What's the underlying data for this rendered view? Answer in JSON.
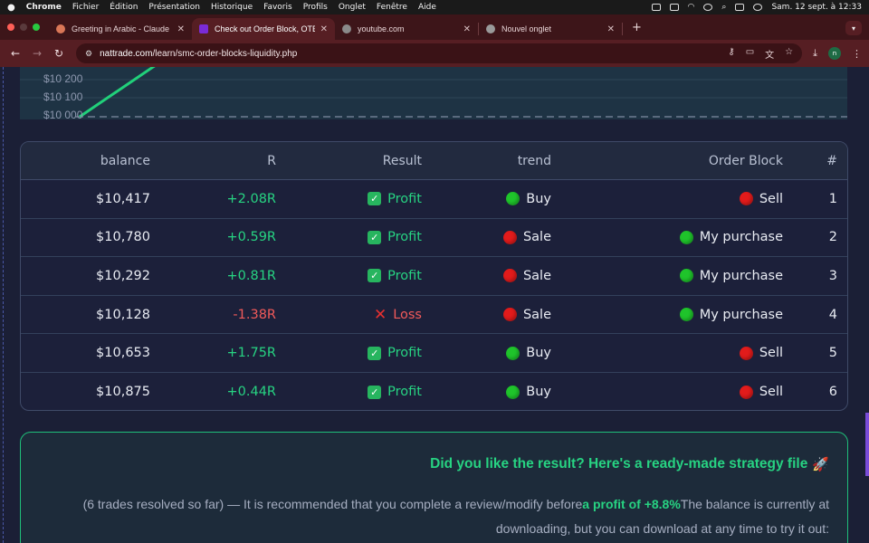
{
  "menubar": {
    "items": [
      "Chrome",
      "Fichier",
      "Édition",
      "Présentation",
      "Historique",
      "Favoris",
      "Profils",
      "Onglet",
      "Fenêtre",
      "Aide"
    ],
    "datetime": "Sam. 12 sept. à  12:33"
  },
  "tabs": [
    {
      "title": "Greeting in Arabic - Claude",
      "favicon_color": "#d97757"
    },
    {
      "title": "Check out Order Block, OTE,",
      "favicon_color": "#7a2bd6"
    },
    {
      "title": "youtube.com",
      "favicon_color": "#8a8a8a"
    },
    {
      "title": "Nouvel onglet",
      "favicon_color": "#9a9a9a"
    }
  ],
  "address_bar": {
    "host": "nattrade.com",
    "path": "/learn/smc-order-blocks-liquidity.php",
    "profile_initial": "n"
  },
  "chart": {
    "y_ticks": [
      "$10 200",
      "$10 100",
      "$10 000"
    ]
  },
  "table": {
    "headers": {
      "balance": "balance",
      "r": "R",
      "result": "Result",
      "trend": "trend",
      "order_block": "Order Block",
      "num": "#"
    },
    "rows": [
      {
        "balance": "$10,417",
        "r": "+2.08R",
        "result": "Profit",
        "trend": "Buy",
        "order_block": "Sell",
        "num": "1"
      },
      {
        "balance": "$10,780",
        "r": "+0.59R",
        "result": "Profit",
        "trend": "Sale",
        "order_block": "My purchase",
        "num": "2"
      },
      {
        "balance": "$10,292",
        "r": "+0.81R",
        "result": "Profit",
        "trend": "Sale",
        "order_block": "My purchase",
        "num": "3"
      },
      {
        "balance": "$10,128",
        "r": "-1.38R",
        "result": "Loss",
        "trend": "Sale",
        "order_block": "My purchase",
        "num": "4"
      },
      {
        "balance": "$10,653",
        "r": "+1.75R",
        "result": "Profit",
        "trend": "Buy",
        "order_block": "Sell",
        "num": "5"
      },
      {
        "balance": "$10,875",
        "r": "+0.44R",
        "result": "Profit",
        "trend": "Buy",
        "order_block": "Sell",
        "num": "6"
      }
    ]
  },
  "promo": {
    "title": "Did you like the result? Here's a ready-made strategy file",
    "text_before": "(6 trades resolved so far) — It is recommended that you complete a review/modify before",
    "highlight": "a profit of +8.8%",
    "text_after": "The balance is currently at downloading, but you can download at any time to try it out:"
  }
}
